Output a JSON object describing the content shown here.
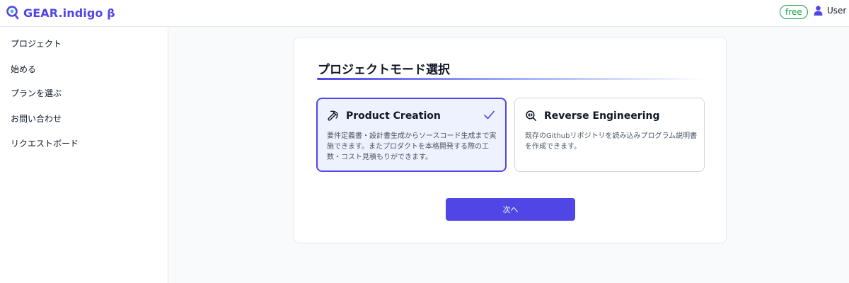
{
  "header": {
    "app_name": "GEAR.indigo β",
    "logo_icon": "magnifier-logo-icon",
    "plan_badge": "free",
    "user_label": "User",
    "user_icon": "user-icon"
  },
  "sidebar": {
    "items": [
      {
        "label": "プロジェクト"
      },
      {
        "label": "始める"
      },
      {
        "label": "プランを選ぶ"
      },
      {
        "label": "お問い合わせ"
      },
      {
        "label": "リクエストボード"
      }
    ]
  },
  "main": {
    "title": "プロジェクトモード選択",
    "options": [
      {
        "title": "Product Creation",
        "description": "要件定義書・設計書生成からソースコード生成まで実施できます。またプロダクトを本格開発する際の工数・コスト見積もりができます。",
        "icon": "pickaxe-icon",
        "selected": true
      },
      {
        "title": "Reverse Engineering",
        "description": "既存のGithubリポジトリを読み込みプログラム説明書を作成できます。",
        "icon": "search-code-icon",
        "selected": false
      }
    ],
    "next_label": "次へ"
  },
  "colors": {
    "accent": "#4f46e5",
    "selected_bg": "#eef2ff",
    "badge_green": "#16a34a"
  }
}
